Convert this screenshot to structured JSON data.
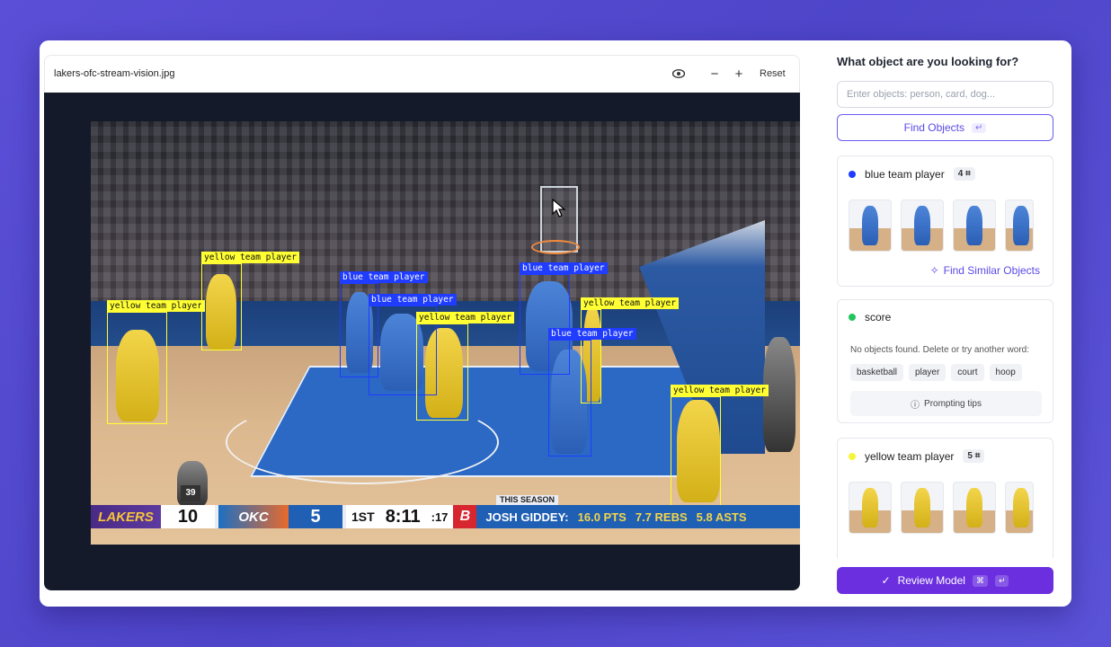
{
  "viewer": {
    "file_name": "lakers-ofc-stream-vision.jpg",
    "eye_icon": "eye-icon",
    "zoom_out": "−",
    "zoom_in": "+",
    "reset_label": "Reset"
  },
  "detections": [
    {
      "label": "yellow team player",
      "color": "yellow"
    },
    {
      "label": "yellow team player",
      "color": "yellow"
    },
    {
      "label": "blue team player",
      "color": "blue"
    },
    {
      "label": "blue team player",
      "color": "blue"
    },
    {
      "label": "yellow team player",
      "color": "yellow"
    },
    {
      "label": "blue team player",
      "color": "blue"
    },
    {
      "label": "yellow team player",
      "color": "yellow"
    },
    {
      "label": "blue team player",
      "color": "blue"
    },
    {
      "label": "yellow team player",
      "color": "yellow"
    }
  ],
  "scoreboard": {
    "team1": "LAKERS",
    "score1": "10",
    "team2": "OKC",
    "score2": "5",
    "period": "1ST",
    "clock": "8:11",
    "shot_clock": ":17",
    "network": "B",
    "this_season": "THIS SEASON",
    "player": "JOSH GIDDEY:",
    "pts": "16.0 PTS",
    "rebs": "7.7 REBS",
    "asts": "5.8 ASTS",
    "ref_number": "39"
  },
  "panel": {
    "title": "What object are you looking for?",
    "search_placeholder": "Enter objects: person, card, dog...",
    "find_label": "Find Objects",
    "find_shortcut": "↵",
    "cards": [
      {
        "name": "blue team player",
        "color": "#1f3cff",
        "count": "4",
        "similar_label": "Find Similar Objects"
      },
      {
        "name": "score",
        "color": "#22c55e",
        "empty_text": "No objects found. Delete or try another word:",
        "suggestions": [
          "basketball",
          "player",
          "court",
          "hoop"
        ],
        "tips_label": "Prompting tips"
      },
      {
        "name": "yellow team player",
        "color": "#f5f53a",
        "count": "5"
      }
    ],
    "review_label": "Review Model",
    "review_shortcut_1": "⌘",
    "review_shortcut_2": "↵"
  }
}
